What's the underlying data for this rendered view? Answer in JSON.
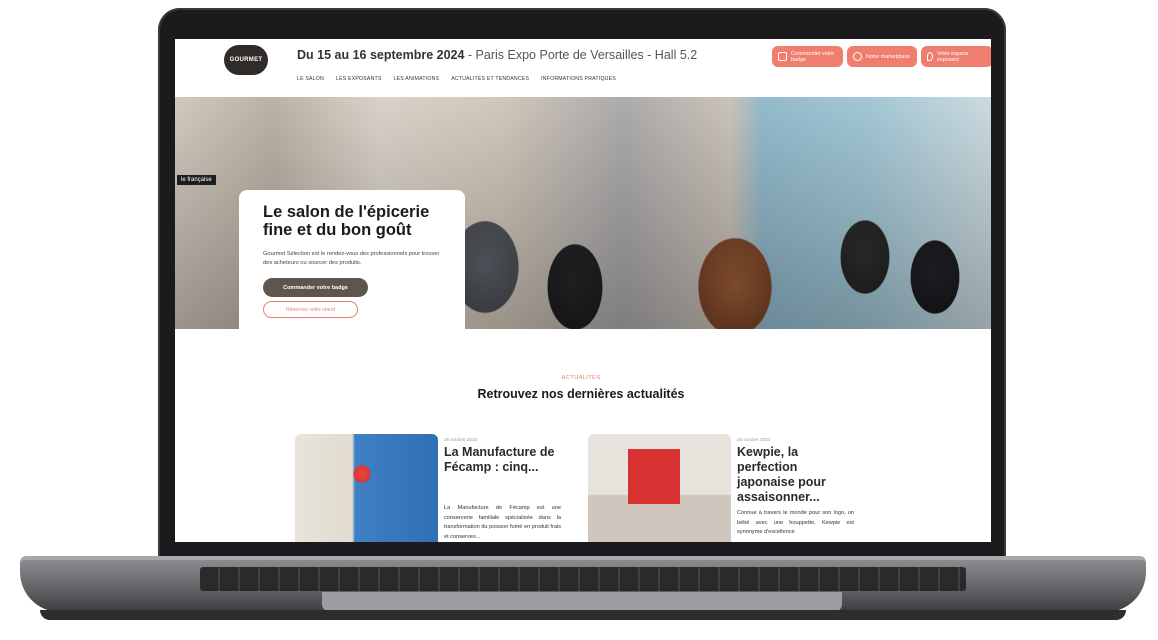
{
  "header": {
    "logo_text": "GOURMET",
    "event_dates": "Du 15 au 16 septembre 2024",
    "event_place": " - Paris Expo Porte de Versailles - Hall 5.2",
    "nav": [
      "LE SALON",
      "LES EXPOSANTS",
      "LES ANIMATIONS",
      "ACTUALITÉS ET TENDANCES",
      "INFORMATIONS PRATIQUES"
    ],
    "buttons": [
      {
        "label": "Commander votre badge",
        "icon": "badge-icon"
      },
      {
        "label": "Notre marketplace",
        "icon": "basket-icon"
      },
      {
        "label": "Votre espace exposant",
        "icon": "pin-icon"
      }
    ],
    "accent": "#ef7e6f"
  },
  "hero": {
    "sign_text": "le française",
    "title": "Le salon de l'épicerie fine et du bon goût",
    "text": "Gourmet Sélection est le rendez-vous des professionnels pour trouver des acheteurs ou sourcer des produits.",
    "primary_cta": "Commander votre badge",
    "secondary_cta": "Réservez votre stand"
  },
  "news": {
    "kicker": "ACTUALITÉS",
    "title": "Retrouvez nos dernières actualités",
    "articles": [
      {
        "date": "26 octobre 2023",
        "title": "La Manufacture de Fécamp : cinq...",
        "excerpt": "La Manufacture de Fécamp est une conserverie familiale spécialisée dans la transformation du poisson fumé en produit frais et conserves..."
      },
      {
        "date": "26 octobre 2023",
        "title": "Kewpie, la perfection japonaise pour assaisonner...",
        "excerpt": "Connue à travers le monde pour son logo, un bébé avec une houppette, Kewpie est synonyme d'excellence"
      }
    ]
  }
}
